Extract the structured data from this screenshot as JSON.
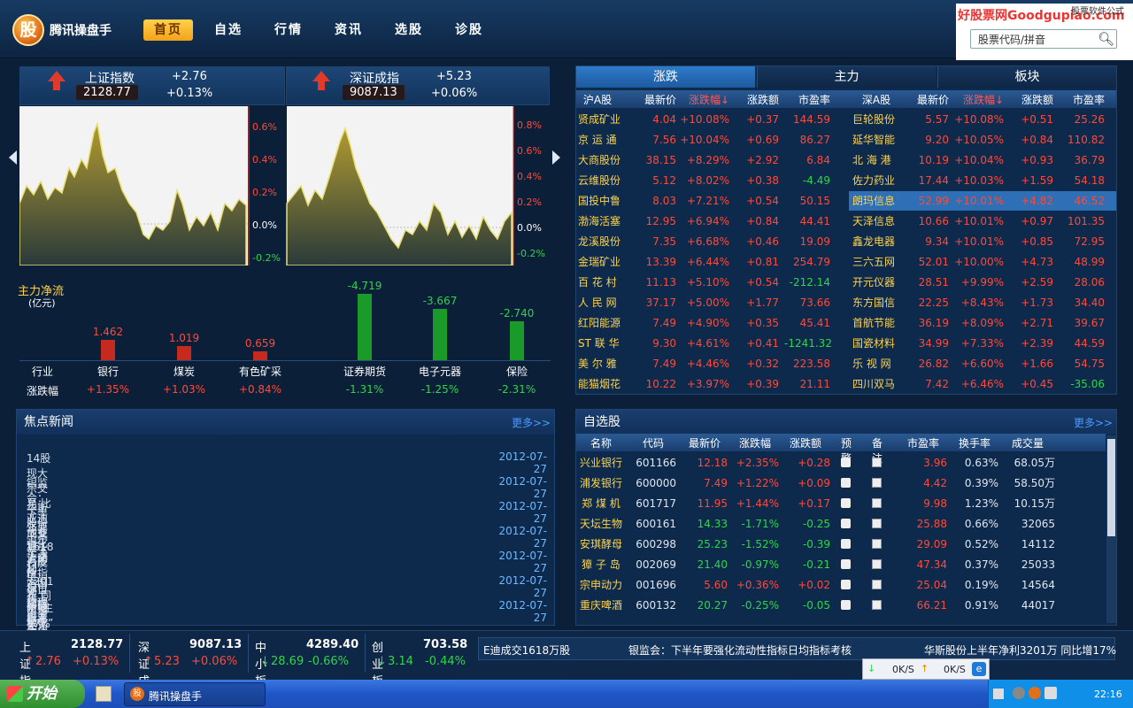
{
  "app": {
    "name": "腾讯操盘手",
    "logo": "股"
  },
  "nav": [
    {
      "label": "首页",
      "active": true
    },
    {
      "label": "自选"
    },
    {
      "label": "行情"
    },
    {
      "label": "资讯"
    },
    {
      "label": "选股"
    },
    {
      "label": "诊股"
    }
  ],
  "brand": {
    "text": "好股票网Goodgupiao.com",
    "sub": "股票软件公式"
  },
  "search": {
    "placeholder": "股票代码/拼音"
  },
  "index_sh": {
    "name": "上证指数",
    "value": "2128.77",
    "change": "+2.76",
    "pct": "+0.13%",
    "axis": [
      "0.6%",
      "0.4%",
      "0.2%",
      "0.0%",
      "-0.2%"
    ]
  },
  "index_sz": {
    "name": "深证成指",
    "value": "9087.13",
    "change": "+5.23",
    "pct": "+0.06%",
    "axis": [
      "0.8%",
      "0.6%",
      "0.4%",
      "0.2%",
      "0.0%",
      "-0.2%"
    ]
  },
  "flow": {
    "title": "主力净流",
    "unit": "(亿元)",
    "row_label_ind": "行业",
    "row_label_pct": "涨跌幅",
    "items": [
      {
        "name": "银行",
        "value": "1.462",
        "pct": "+1.35%",
        "v": 1.462,
        "dir": "up"
      },
      {
        "name": "煤炭",
        "value": "1.019",
        "pct": "+1.03%",
        "v": 1.019,
        "dir": "up"
      },
      {
        "name": "有色矿采",
        "value": "0.659",
        "pct": "+0.84%",
        "v": 0.659,
        "dir": "up"
      },
      {
        "name": "证券期货",
        "value": "-4.719",
        "pct": "-1.31%",
        "v": 4.719,
        "dir": "down"
      },
      {
        "name": "电子元器",
        "value": "-3.667",
        "pct": "-1.25%",
        "v": 3.667,
        "dir": "down"
      },
      {
        "name": "保险",
        "value": "-2.740",
        "pct": "-2.31%",
        "v": 2.74,
        "dir": "down"
      }
    ]
  },
  "tabs": [
    {
      "label": "涨跌",
      "active": true
    },
    {
      "label": "主力"
    },
    {
      "label": "板块"
    }
  ],
  "rank": {
    "sh_headers": [
      "沪A股",
      "最新价",
      "涨跌幅↓",
      "涨跌额",
      "市盈率"
    ],
    "sz_headers": [
      "深A股",
      "最新价",
      "涨跌幅↓",
      "涨跌额",
      "市盈率"
    ],
    "sh": [
      [
        "贤成矿业",
        "4.04",
        "+10.08%",
        "+0.37",
        "144.59"
      ],
      [
        "京 运 通",
        "7.56",
        "+10.04%",
        "+0.69",
        "86.27"
      ],
      [
        "大商股份",
        "38.15",
        "+8.29%",
        "+2.92",
        "6.84"
      ],
      [
        "云维股份",
        "5.12",
        "+8.02%",
        "+0.38",
        "-4.49"
      ],
      [
        "国投中鲁",
        "8.03",
        "+7.21%",
        "+0.54",
        "50.15"
      ],
      [
        "渤海活塞",
        "12.95",
        "+6.94%",
        "+0.84",
        "44.41"
      ],
      [
        "龙溪股份",
        "7.35",
        "+6.68%",
        "+0.46",
        "19.09"
      ],
      [
        "金瑞矿业",
        "13.39",
        "+6.44%",
        "+0.81",
        "254.79"
      ],
      [
        "百 花 村",
        "11.13",
        "+5.10%",
        "+0.54",
        "-212.14"
      ],
      [
        "人 民 网",
        "37.17",
        "+5.00%",
        "+1.77",
        "73.66"
      ],
      [
        "红阳能源",
        "7.49",
        "+4.90%",
        "+0.35",
        "45.41"
      ],
      [
        "ST 联 华",
        "9.30",
        "+4.61%",
        "+0.41",
        "-1241.32"
      ],
      [
        "美 尔 雅",
        "7.49",
        "+4.46%",
        "+0.32",
        "223.58"
      ],
      [
        "能猫烟花",
        "10.22",
        "+3.97%",
        "+0.39",
        "21.11"
      ]
    ],
    "sz": [
      [
        "巨轮股份",
        "5.57",
        "+10.08%",
        "+0.51",
        "25.26"
      ],
      [
        "延华智能",
        "9.20",
        "+10.05%",
        "+0.84",
        "110.82"
      ],
      [
        "北 海 港",
        "10.19",
        "+10.04%",
        "+0.93",
        "36.79"
      ],
      [
        "佐力药业",
        "17.44",
        "+10.03%",
        "+1.59",
        "54.18"
      ],
      [
        "朗玛信息",
        "52.99",
        "+10.01%",
        "+4.82",
        "46.52"
      ],
      [
        "天泽信息",
        "10.66",
        "+10.01%",
        "+0.97",
        "101.35"
      ],
      [
        "鑫龙电器",
        "9.34",
        "+10.01%",
        "+0.85",
        "72.95"
      ],
      [
        "三六五网",
        "52.01",
        "+10.00%",
        "+4.73",
        "48.99"
      ],
      [
        "开元仪器",
        "28.51",
        "+9.99%",
        "+2.59",
        "28.06"
      ],
      [
        "东方国信",
        "22.25",
        "+8.43%",
        "+1.73",
        "34.40"
      ],
      [
        "首航节能",
        "36.19",
        "+8.09%",
        "+2.71",
        "39.67"
      ],
      [
        "国瓷材料",
        "34.99",
        "+7.33%",
        "+2.39",
        "44.59"
      ],
      [
        "乐 视 网",
        "26.82",
        "+6.60%",
        "+1.66",
        "54.75"
      ],
      [
        "四川双马",
        "7.42",
        "+6.46%",
        "+0.45",
        "-35.06"
      ]
    ],
    "selected_sz_row": 4
  },
  "news": {
    "title": "焦点新闻",
    "more": "更多>>",
    "items": [
      {
        "text": "14股现大宗交易 比亚迪成交1618万股",
        "date": "2012-07-27"
      },
      {
        "text": "银监会：下半年要强化流动性指标日均指标考核",
        "date": "2012-07-27"
      },
      {
        "text": "华斯股份上半年净利3201万 同比增17%",
        "date": "2012-07-27"
      },
      {
        "text": "创业板千日反思：须防“主板化”",
        "date": "2012-07-27"
      },
      {
        "text": "上交所：退市整理股票简称前将冠“退市”标识",
        "date": "2012-07-27"
      },
      {
        "text": "六国化工上半年净利4150万 同比降35%",
        "date": "2012-07-27"
      },
      {
        "text": "新联电子上半年净利5333万 同比增48%",
        "date": "2012-07-27"
      }
    ]
  },
  "watch": {
    "title": "自选股",
    "more": "更多>>",
    "headers": [
      "名称",
      "代码",
      "最新价",
      "涨跌幅",
      "涨跌额",
      "预警",
      "备注",
      "市盈率",
      "换手率",
      "成交量"
    ],
    "rows": [
      [
        "兴业银行",
        "601166",
        "12.18",
        "+2.35%",
        "+0.28",
        "3.96",
        "0.63%",
        "68.05万"
      ],
      [
        "浦发银行",
        "600000",
        "7.49",
        "+1.22%",
        "+0.09",
        "4.42",
        "0.39%",
        "58.50万"
      ],
      [
        "郑 煤 机",
        "601717",
        "11.95",
        "+1.44%",
        "+0.17",
        "9.98",
        "1.23%",
        "10.15万"
      ],
      [
        "天坛生物",
        "600161",
        "14.33",
        "-1.71%",
        "-0.25",
        "25.88",
        "0.66%",
        "32065"
      ],
      [
        "安琪酵母",
        "600298",
        "25.23",
        "-1.52%",
        "-0.39",
        "29.09",
        "0.52%",
        "14112"
      ],
      [
        "獐 子 岛",
        "002069",
        "21.40",
        "-0.97%",
        "-0.21",
        "47.34",
        "0.37%",
        "25033"
      ],
      [
        "宗申动力",
        "001696",
        "5.60",
        "+0.36%",
        "+0.02",
        "25.04",
        "0.19%",
        "14564"
      ],
      [
        "重庆啤酒",
        "600132",
        "20.27",
        "-0.25%",
        "-0.05",
        "66.21",
        "0.91%",
        "44017"
      ]
    ]
  },
  "ticker_idx": [
    {
      "name": "上证指数",
      "value": "2128.77",
      "chg": "2.76",
      "pct": "+0.13%",
      "dir": "up"
    },
    {
      "name": "深证成指",
      "value": "9087.13",
      "chg": "5.23",
      "pct": "+0.06%",
      "dir": "up"
    },
    {
      "name": "中小板指",
      "value": "4289.40",
      "chg": "28.69",
      "pct": "-0.66%",
      "dir": "down"
    },
    {
      "name": "创业板指",
      "value": "703.58",
      "chg": "3.14",
      "pct": "-0.44%",
      "dir": "down"
    }
  ],
  "ticker_news": [
    "E迪成交1618万股",
    "银监会：下半年要强化流动性指标日均指标考核",
    "华斯股份上半年净利3201万 同比增17%"
  ],
  "netspeed": {
    "down": "0K/S",
    "up": "0K/S"
  },
  "taskbar": {
    "start": "开始",
    "task": "腾讯操盘手",
    "clock": "22:16"
  },
  "colors": {
    "up": "#ff4a3a",
    "down": "#2fd54a",
    "accent": "#ffd24a",
    "bg": "#0b1f38"
  }
}
